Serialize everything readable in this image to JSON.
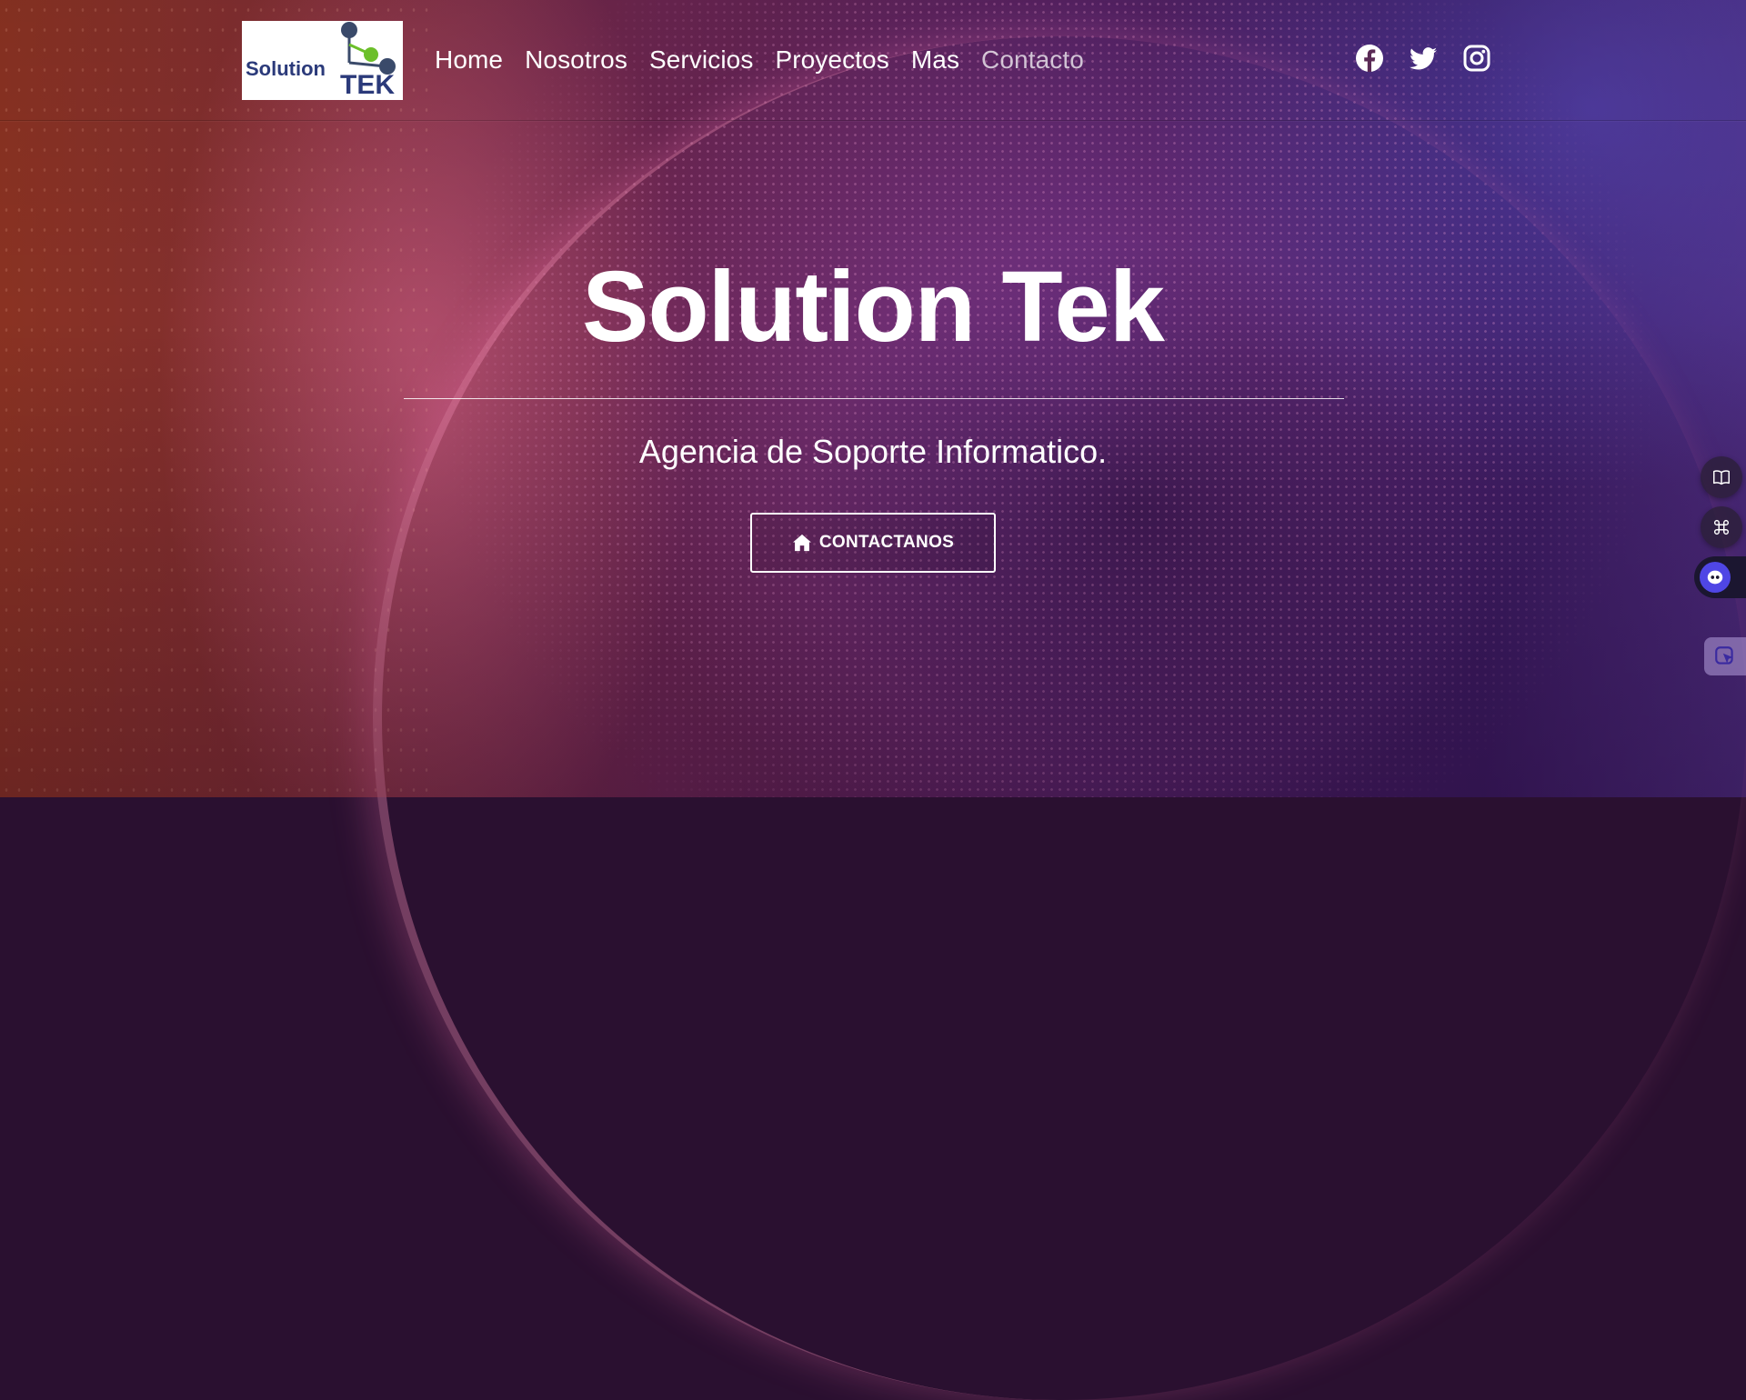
{
  "brand": {
    "logo_text_solution": "Solution",
    "logo_text_tek": "TEK",
    "logo_colors": {
      "blue": "#2b3a7a",
      "green": "#6cbf2a",
      "node": "#3a4a6a"
    }
  },
  "nav": {
    "items": [
      {
        "label": "Home"
      },
      {
        "label": "Nosotros"
      },
      {
        "label": "Servicios"
      },
      {
        "label": "Proyectos"
      },
      {
        "label": "Mas"
      },
      {
        "label": "Contacto"
      }
    ]
  },
  "social": {
    "icons": [
      "facebook-icon",
      "twitter-icon",
      "instagram-icon"
    ]
  },
  "hero": {
    "title": "Solution Tek",
    "subtitle": "Agencia de Soporte Informatico.",
    "cta_label": "CONTACTANOS",
    "cta_icon": "home-icon"
  },
  "widgets": {
    "icons": [
      "book-icon",
      "command-icon",
      "assistant-icon",
      "cursor-icon"
    ]
  },
  "colors": {
    "text": "#ffffff",
    "bg_left": "#8a3222",
    "bg_right": "#3a1a5e",
    "assistant": "#4f46e5"
  }
}
